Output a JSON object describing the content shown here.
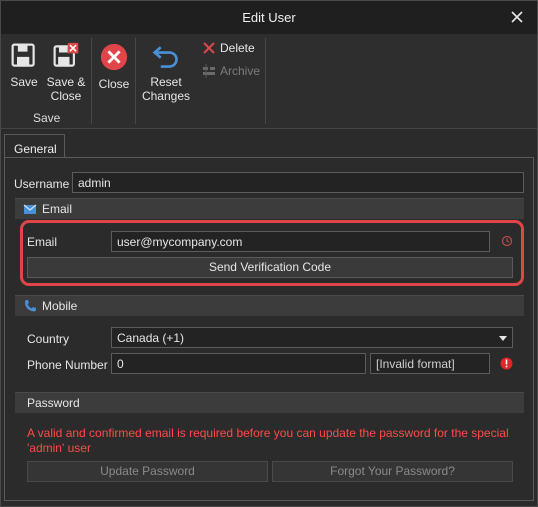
{
  "window": {
    "title": "Edit User"
  },
  "ribbon": {
    "save_label": "Save",
    "save_close_label": "Save & Close",
    "close_label": "Close",
    "reset_label": "Reset Changes",
    "delete_label": "Delete",
    "archive_label": "Archive",
    "group_save_label": "Save"
  },
  "tabs": [
    {
      "label": "General"
    }
  ],
  "username": {
    "label": "Username",
    "value": "admin"
  },
  "email_section": {
    "header": "Email",
    "email_label": "Email",
    "email_value": "user@mycompany.com",
    "send_code_label": "Send Verification Code"
  },
  "mobile_section": {
    "header": "Mobile",
    "country_label": "Country",
    "country_value": "Canada (+1)",
    "phone_label": "Phone Number",
    "phone_value": "0",
    "phone_format": "[Invalid format]"
  },
  "password_section": {
    "header": "Password",
    "error_message": "A valid and confirmed email is required before you can update the password for the special 'admin' user",
    "update_label": "Update Password",
    "forgot_label": "Forgot Your Password?"
  },
  "colors": {
    "accent_red": "#e0454a",
    "error_red": "#ff4a4a",
    "icon_blue": "#4a90d9"
  }
}
